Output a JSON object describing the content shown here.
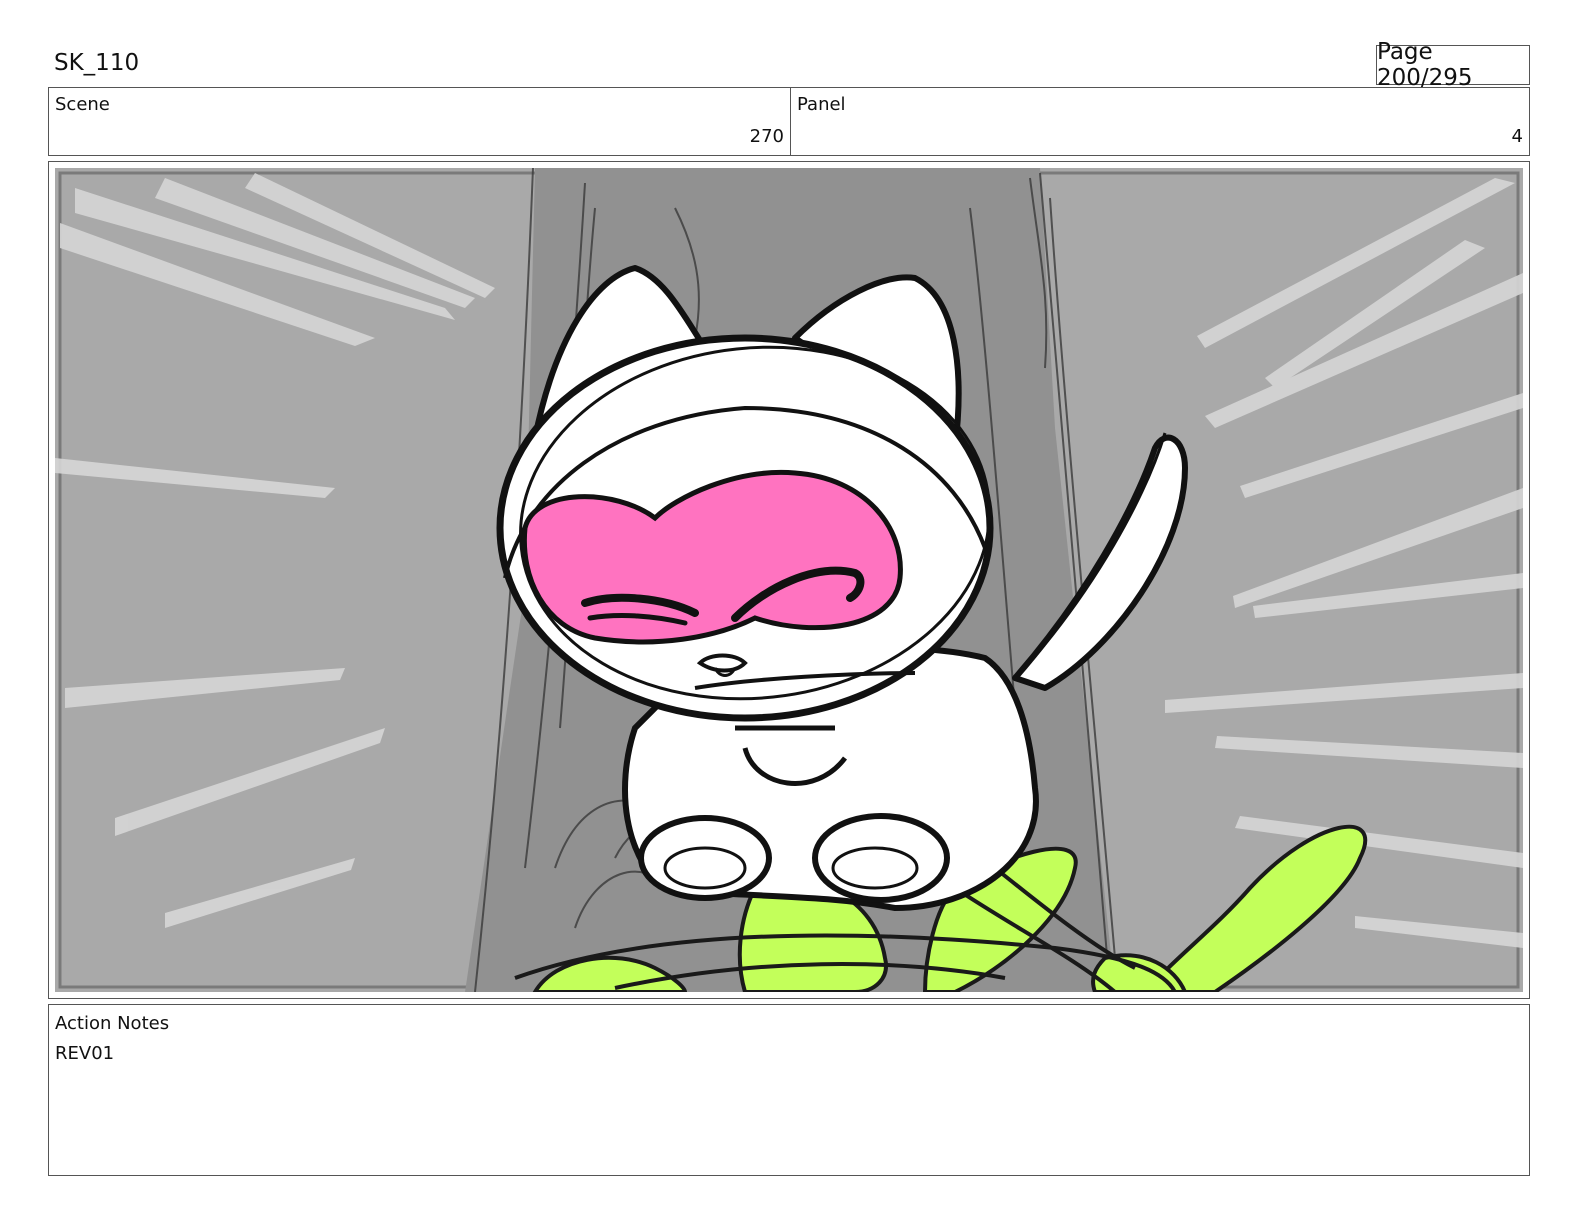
{
  "header": {
    "title": "SK_110",
    "page": "Page 200/295"
  },
  "scene": {
    "label": "Scene",
    "value": "270"
  },
  "panel": {
    "label": "Panel",
    "value": "4"
  },
  "frame": {
    "colors": {
      "background": "#a9a9a9",
      "tree": "#8f8f8f",
      "character": "#ffffff",
      "mask": "#ff73c0",
      "splash": "#c3ff5a",
      "ink": "#111111"
    }
  },
  "notes": {
    "label": "Action Notes",
    "text": "REV01"
  }
}
